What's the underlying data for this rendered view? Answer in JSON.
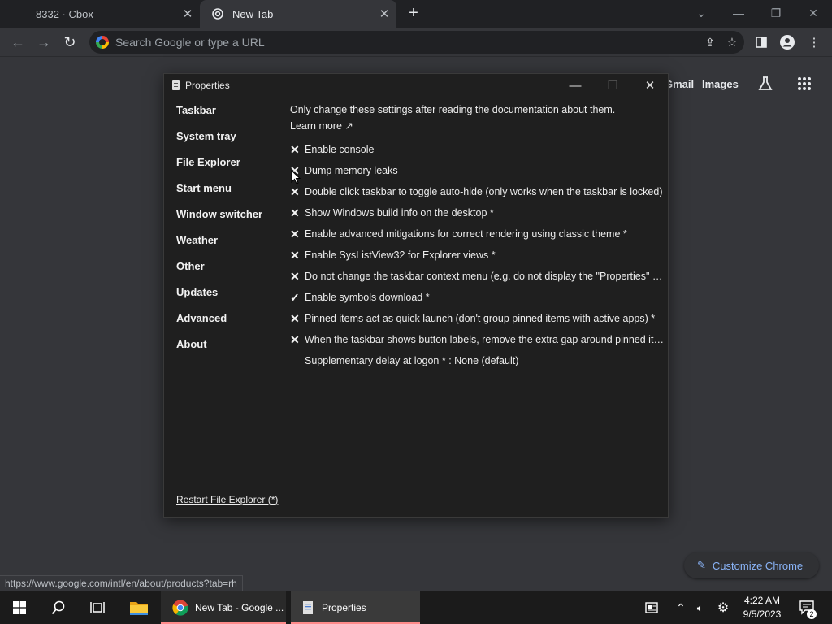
{
  "browser": {
    "tabs": [
      {
        "title": "8332 · Cbox"
      },
      {
        "title": "New Tab"
      }
    ],
    "omnibox_placeholder": "Search Google or type a URL",
    "status_url": "https://www.google.com/intl/en/about/products?tab=rh"
  },
  "ntp": {
    "links": {
      "gmail": "Gmail",
      "images": "Images"
    },
    "customize_label": "Customize Chrome"
  },
  "properties": {
    "title": "Properties",
    "nav": [
      {
        "label": "Taskbar"
      },
      {
        "label": "System tray"
      },
      {
        "label": "File Explorer"
      },
      {
        "label": "Start menu"
      },
      {
        "label": "Window switcher"
      },
      {
        "label": "Weather"
      },
      {
        "label": "Other"
      },
      {
        "label": "Updates"
      },
      {
        "label": "Advanced",
        "active": true
      },
      {
        "label": "About"
      }
    ],
    "note": "Only change these settings after reading the documentation about them.",
    "learn_more": "Learn more ↗",
    "options": [
      {
        "mark": "✕",
        "label": "Enable console"
      },
      {
        "mark": "✕",
        "label": "Dump memory leaks"
      },
      {
        "mark": "✕",
        "label": "Double click taskbar to toggle auto-hide (only works when the taskbar is locked)"
      },
      {
        "mark": "✕",
        "label": "Show Windows build info on the desktop *"
      },
      {
        "mark": "✕",
        "label": "Enable advanced mitigations for correct rendering using classic theme *"
      },
      {
        "mark": "✕",
        "label": "Enable SysListView32 for Explorer views *"
      },
      {
        "mark": "✕",
        "label": "Do not change the taskbar context menu (e.g. do not display the \"Properties\" ite..."
      },
      {
        "mark": "✓",
        "label": "Enable symbols download *"
      },
      {
        "mark": "✕",
        "label": "Pinned items act as quick launch (don't group pinned items with active apps) *"
      },
      {
        "mark": "✕",
        "label": "When the taskbar shows button labels, remove the extra gap around pinned ite..."
      },
      {
        "mark": "",
        "label": "Supplementary delay at logon * : None (default)"
      }
    ],
    "restart_label": "Restart File Explorer (*)"
  },
  "taskbar": {
    "apps": [
      {
        "label": "New Tab - Google ..."
      },
      {
        "label": "Properties"
      }
    ],
    "time": "4:22 AM",
    "date": "9/5/2023",
    "notification_count": "2"
  }
}
